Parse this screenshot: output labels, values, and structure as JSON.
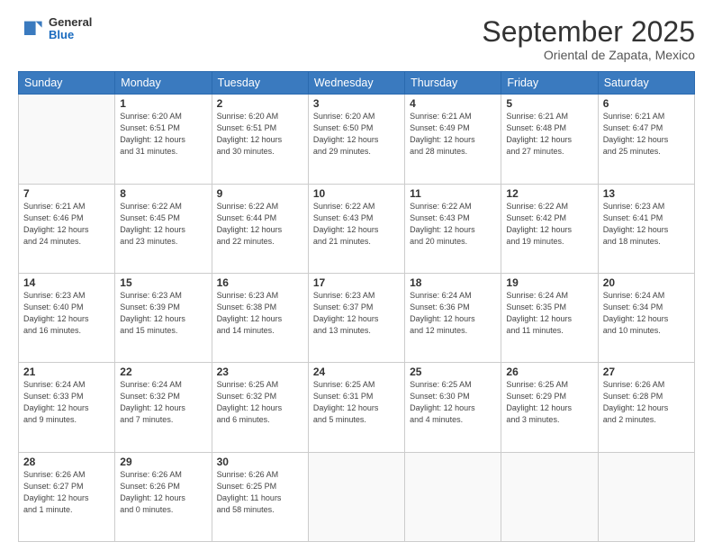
{
  "header": {
    "logo": {
      "general": "General",
      "blue": "Blue"
    },
    "title": "September 2025",
    "location": "Oriental de Zapata, Mexico"
  },
  "weekdays": [
    "Sunday",
    "Monday",
    "Tuesday",
    "Wednesday",
    "Thursday",
    "Friday",
    "Saturday"
  ],
  "weeks": [
    [
      {
        "day": "",
        "info": ""
      },
      {
        "day": "1",
        "info": "Sunrise: 6:20 AM\nSunset: 6:51 PM\nDaylight: 12 hours\nand 31 minutes."
      },
      {
        "day": "2",
        "info": "Sunrise: 6:20 AM\nSunset: 6:51 PM\nDaylight: 12 hours\nand 30 minutes."
      },
      {
        "day": "3",
        "info": "Sunrise: 6:20 AM\nSunset: 6:50 PM\nDaylight: 12 hours\nand 29 minutes."
      },
      {
        "day": "4",
        "info": "Sunrise: 6:21 AM\nSunset: 6:49 PM\nDaylight: 12 hours\nand 28 minutes."
      },
      {
        "day": "5",
        "info": "Sunrise: 6:21 AM\nSunset: 6:48 PM\nDaylight: 12 hours\nand 27 minutes."
      },
      {
        "day": "6",
        "info": "Sunrise: 6:21 AM\nSunset: 6:47 PM\nDaylight: 12 hours\nand 25 minutes."
      }
    ],
    [
      {
        "day": "7",
        "info": "Sunrise: 6:21 AM\nSunset: 6:46 PM\nDaylight: 12 hours\nand 24 minutes."
      },
      {
        "day": "8",
        "info": "Sunrise: 6:22 AM\nSunset: 6:45 PM\nDaylight: 12 hours\nand 23 minutes."
      },
      {
        "day": "9",
        "info": "Sunrise: 6:22 AM\nSunset: 6:44 PM\nDaylight: 12 hours\nand 22 minutes."
      },
      {
        "day": "10",
        "info": "Sunrise: 6:22 AM\nSunset: 6:43 PM\nDaylight: 12 hours\nand 21 minutes."
      },
      {
        "day": "11",
        "info": "Sunrise: 6:22 AM\nSunset: 6:43 PM\nDaylight: 12 hours\nand 20 minutes."
      },
      {
        "day": "12",
        "info": "Sunrise: 6:22 AM\nSunset: 6:42 PM\nDaylight: 12 hours\nand 19 minutes."
      },
      {
        "day": "13",
        "info": "Sunrise: 6:23 AM\nSunset: 6:41 PM\nDaylight: 12 hours\nand 18 minutes."
      }
    ],
    [
      {
        "day": "14",
        "info": "Sunrise: 6:23 AM\nSunset: 6:40 PM\nDaylight: 12 hours\nand 16 minutes."
      },
      {
        "day": "15",
        "info": "Sunrise: 6:23 AM\nSunset: 6:39 PM\nDaylight: 12 hours\nand 15 minutes."
      },
      {
        "day": "16",
        "info": "Sunrise: 6:23 AM\nSunset: 6:38 PM\nDaylight: 12 hours\nand 14 minutes."
      },
      {
        "day": "17",
        "info": "Sunrise: 6:23 AM\nSunset: 6:37 PM\nDaylight: 12 hours\nand 13 minutes."
      },
      {
        "day": "18",
        "info": "Sunrise: 6:24 AM\nSunset: 6:36 PM\nDaylight: 12 hours\nand 12 minutes."
      },
      {
        "day": "19",
        "info": "Sunrise: 6:24 AM\nSunset: 6:35 PM\nDaylight: 12 hours\nand 11 minutes."
      },
      {
        "day": "20",
        "info": "Sunrise: 6:24 AM\nSunset: 6:34 PM\nDaylight: 12 hours\nand 10 minutes."
      }
    ],
    [
      {
        "day": "21",
        "info": "Sunrise: 6:24 AM\nSunset: 6:33 PM\nDaylight: 12 hours\nand 9 minutes."
      },
      {
        "day": "22",
        "info": "Sunrise: 6:24 AM\nSunset: 6:32 PM\nDaylight: 12 hours\nand 7 minutes."
      },
      {
        "day": "23",
        "info": "Sunrise: 6:25 AM\nSunset: 6:32 PM\nDaylight: 12 hours\nand 6 minutes."
      },
      {
        "day": "24",
        "info": "Sunrise: 6:25 AM\nSunset: 6:31 PM\nDaylight: 12 hours\nand 5 minutes."
      },
      {
        "day": "25",
        "info": "Sunrise: 6:25 AM\nSunset: 6:30 PM\nDaylight: 12 hours\nand 4 minutes."
      },
      {
        "day": "26",
        "info": "Sunrise: 6:25 AM\nSunset: 6:29 PM\nDaylight: 12 hours\nand 3 minutes."
      },
      {
        "day": "27",
        "info": "Sunrise: 6:26 AM\nSunset: 6:28 PM\nDaylight: 12 hours\nand 2 minutes."
      }
    ],
    [
      {
        "day": "28",
        "info": "Sunrise: 6:26 AM\nSunset: 6:27 PM\nDaylight: 12 hours\nand 1 minute."
      },
      {
        "day": "29",
        "info": "Sunrise: 6:26 AM\nSunset: 6:26 PM\nDaylight: 12 hours\nand 0 minutes."
      },
      {
        "day": "30",
        "info": "Sunrise: 6:26 AM\nSunset: 6:25 PM\nDaylight: 11 hours\nand 58 minutes."
      },
      {
        "day": "",
        "info": ""
      },
      {
        "day": "",
        "info": ""
      },
      {
        "day": "",
        "info": ""
      },
      {
        "day": "",
        "info": ""
      }
    ]
  ]
}
